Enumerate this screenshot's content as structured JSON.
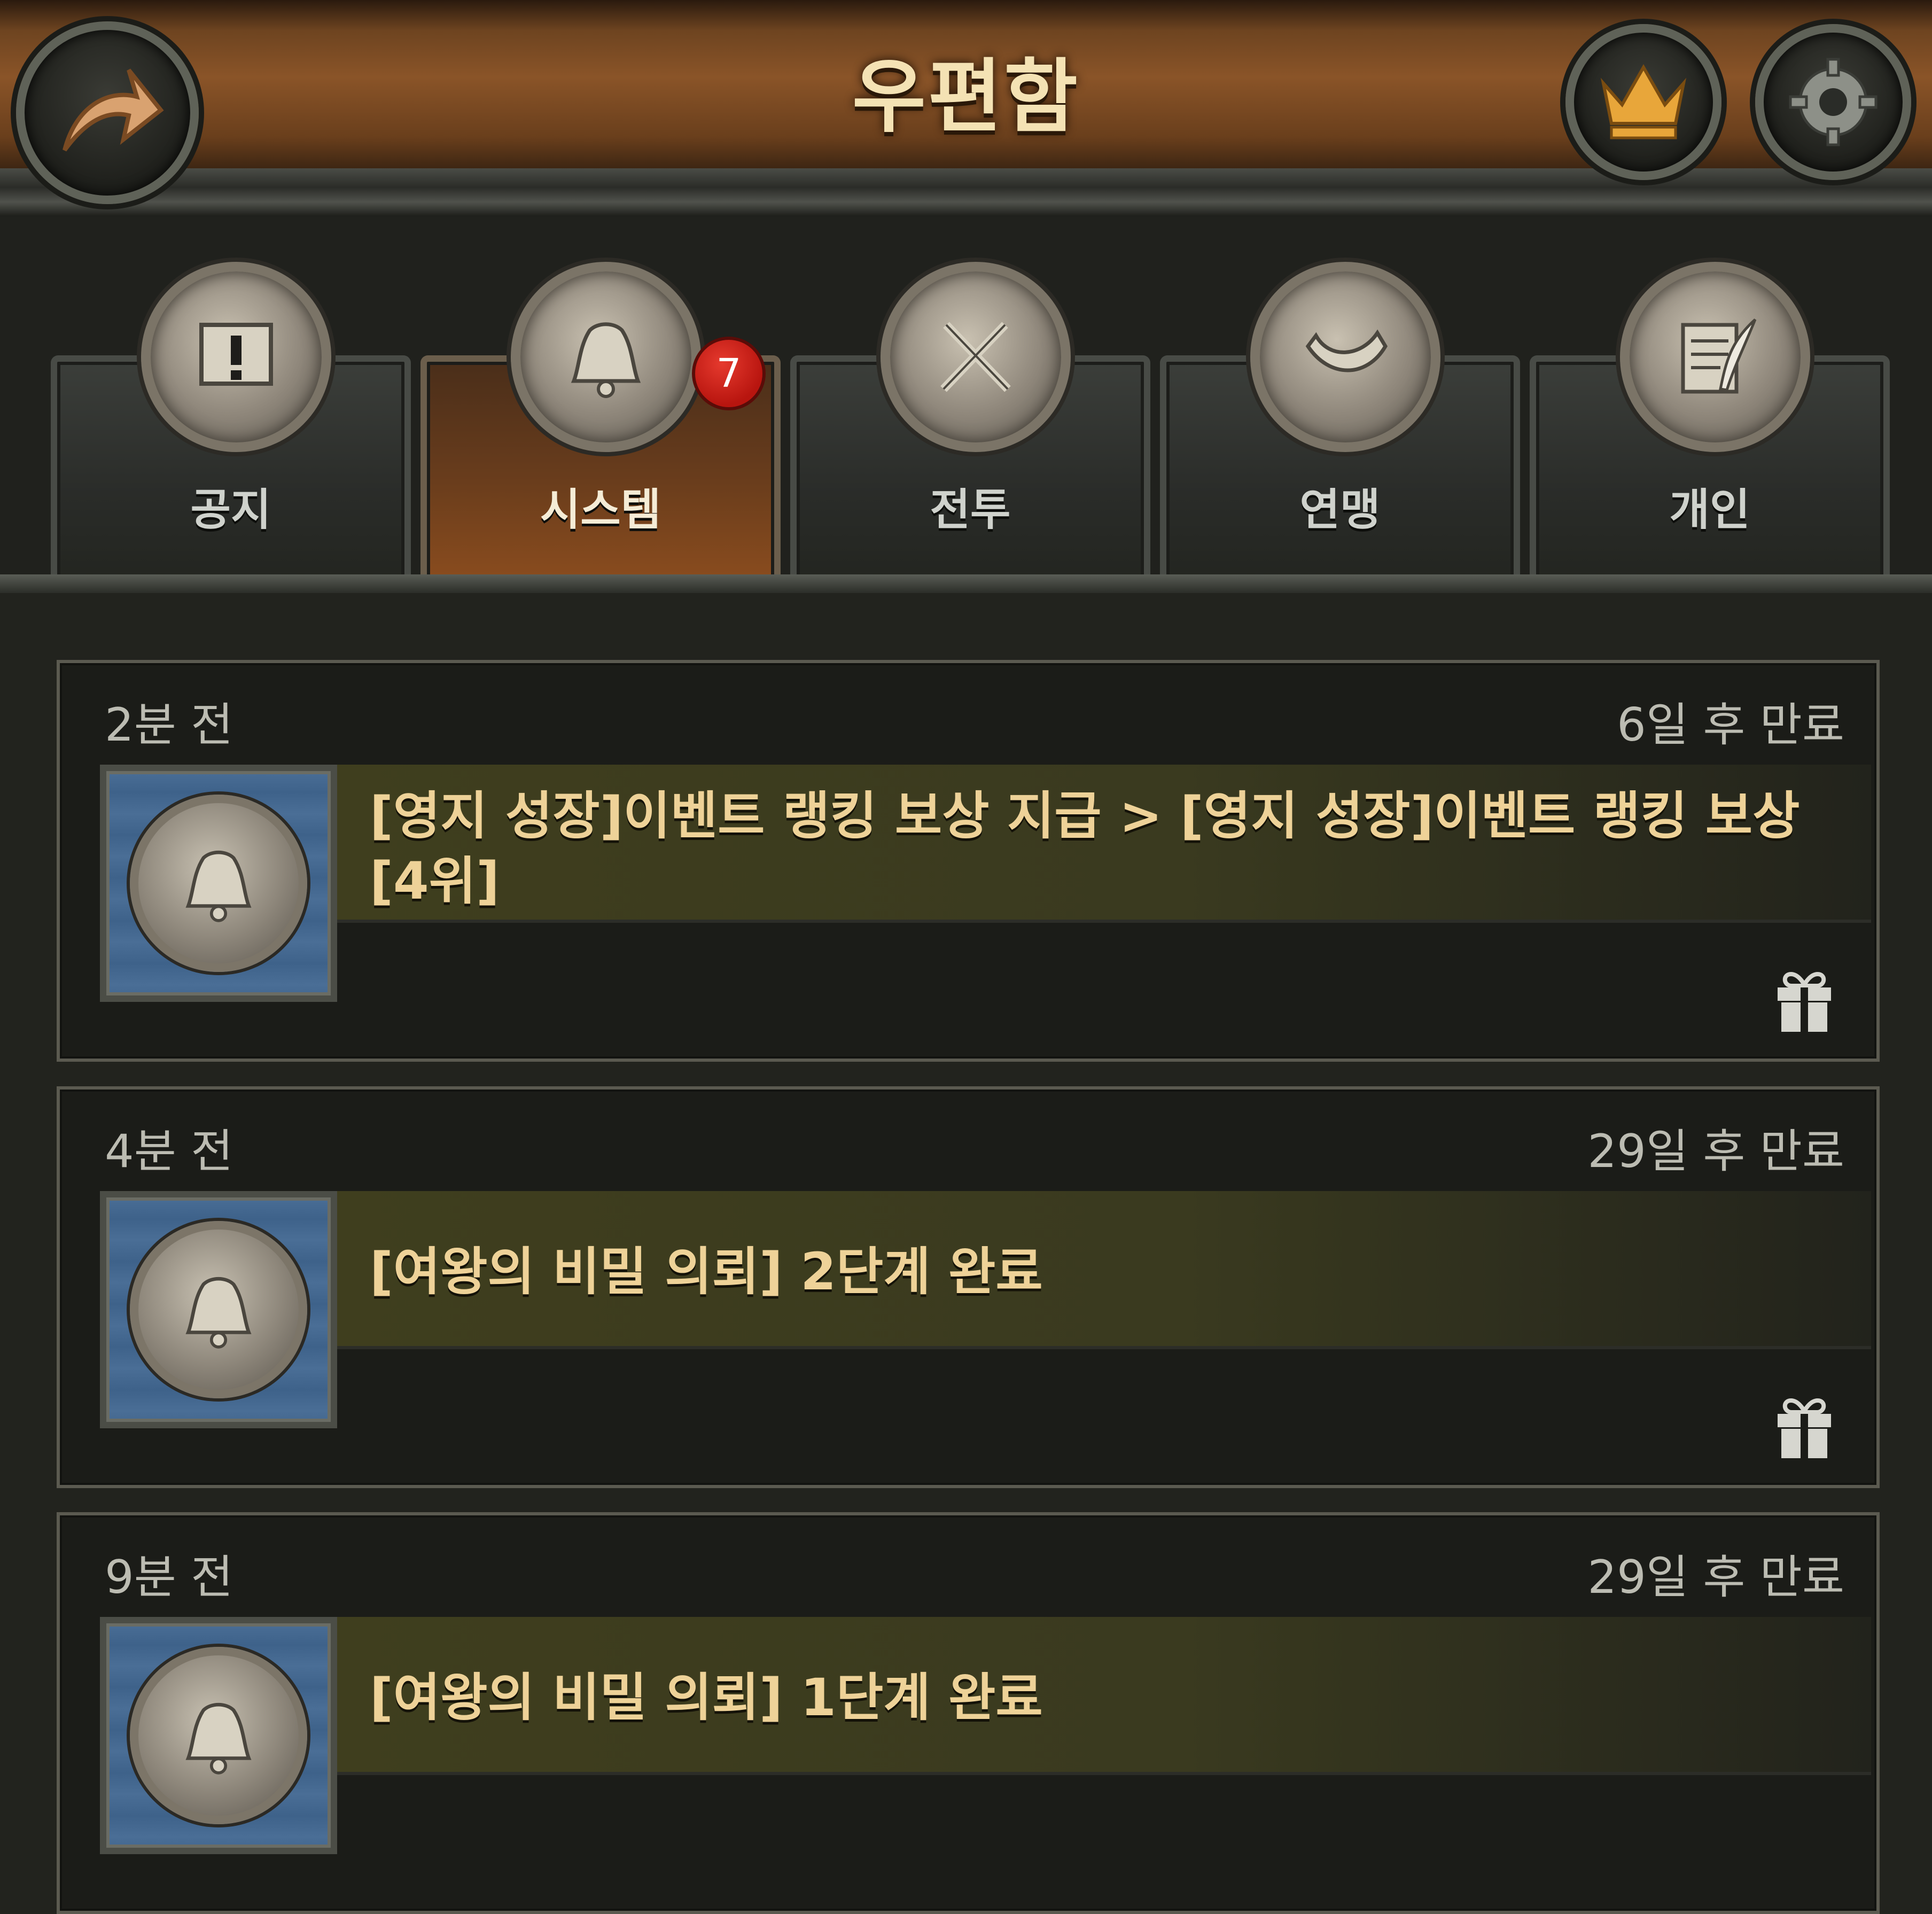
{
  "header": {
    "title": "우편함",
    "back_icon": "back-arrow-icon",
    "crown_icon": "crown-icon",
    "settings_icon": "gear-icon"
  },
  "tabs": [
    {
      "label": "공지",
      "icon": "notice-board-icon",
      "active": false
    },
    {
      "label": "시스템",
      "icon": "bell-icon",
      "active": true,
      "badge": "7"
    },
    {
      "label": "전투",
      "icon": "crossed-swords-icon",
      "active": false
    },
    {
      "label": "연맹",
      "icon": "horn-icon",
      "active": false
    },
    {
      "label": "개인",
      "icon": "letter-quill-icon",
      "active": false
    }
  ],
  "mails": [
    {
      "time": "2분 전",
      "expire": "6일 후 만료",
      "subject": "[영지 성장]이벤트 랭킹 보상 지급 > [영지 성장]이벤트 랭킹 보상 [4위]",
      "has_gift": true
    },
    {
      "time": "4분 전",
      "expire": "29일 후 만료",
      "subject": "[여왕의 비밀 의뢰] 2단계 완료",
      "has_gift": true
    },
    {
      "time": "9분 전",
      "expire": "29일 후 만료",
      "subject": "[여왕의 비밀 의뢰] 1단계 완료",
      "has_gift": true
    }
  ],
  "colors": {
    "subject_text": "#eed298",
    "badge": "#c8201a",
    "active_tab": "#6a3d1c"
  }
}
